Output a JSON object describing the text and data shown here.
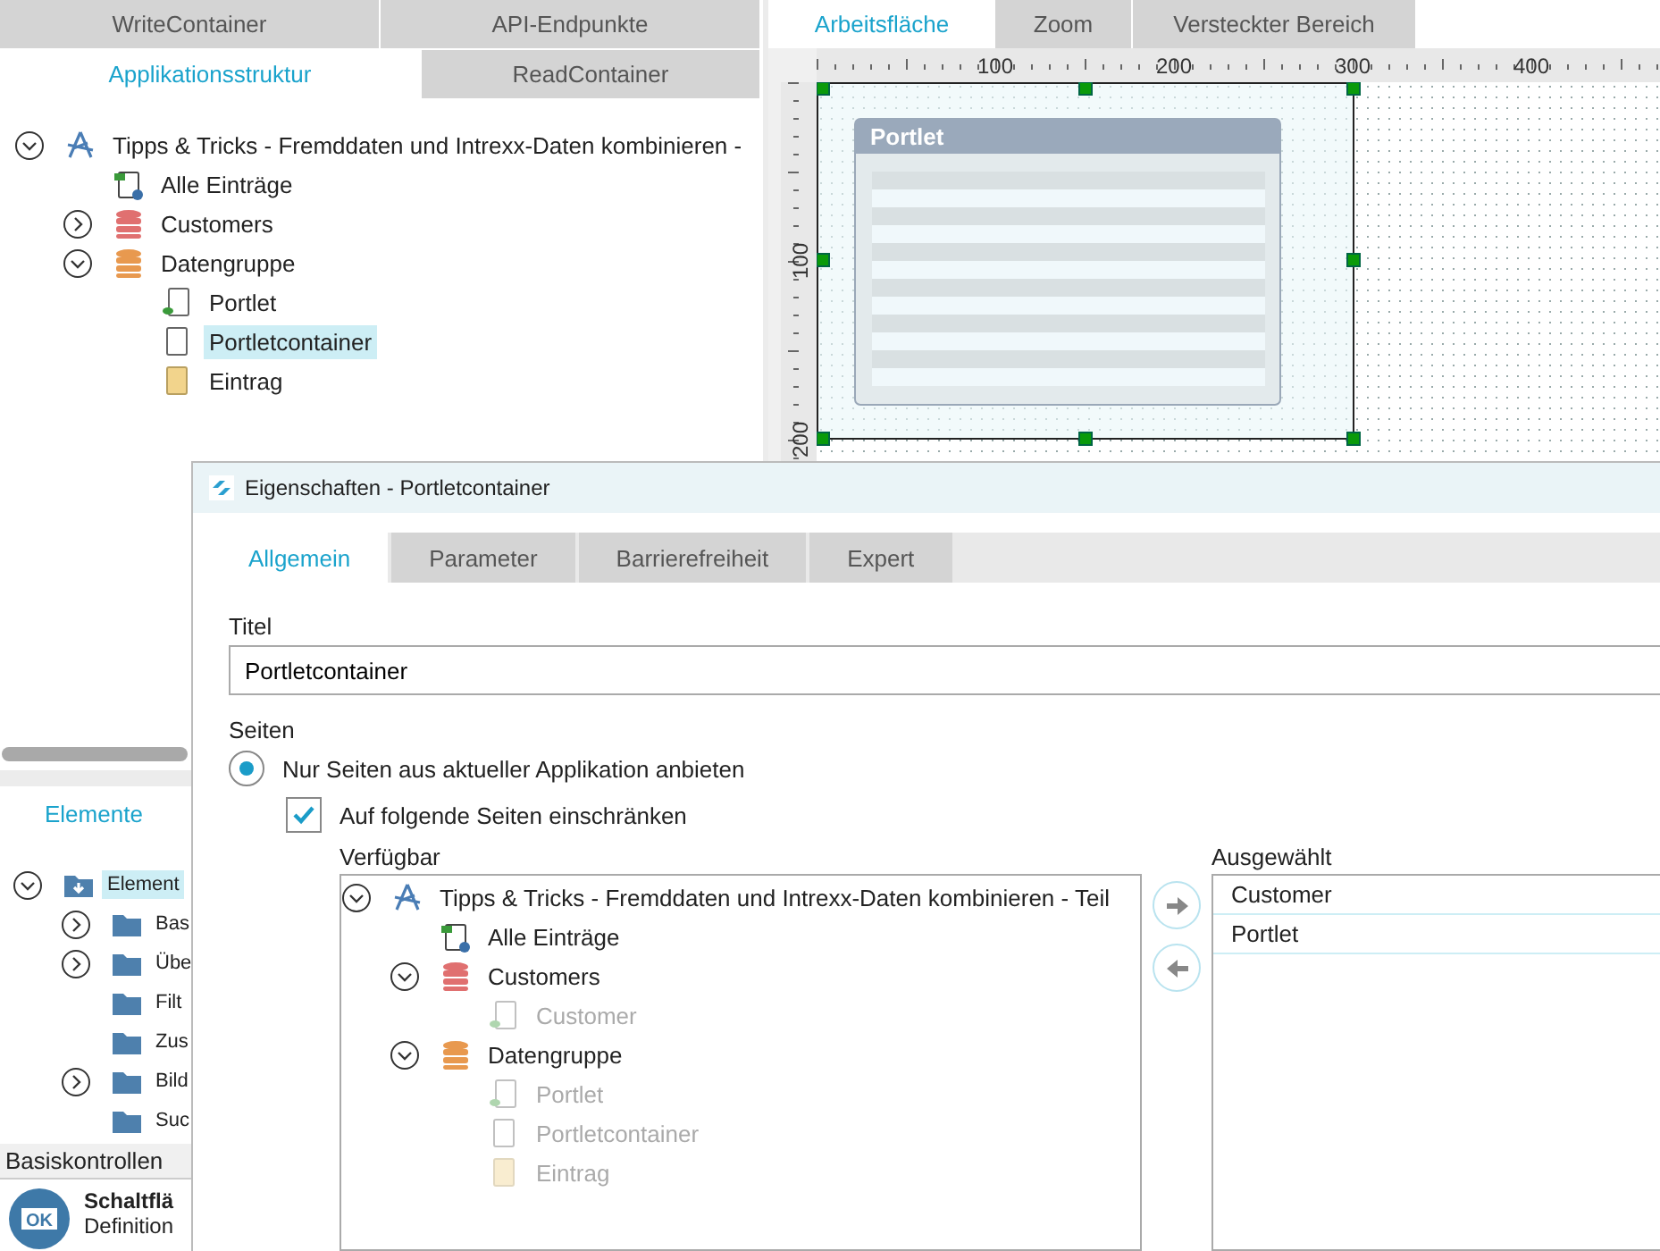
{
  "structure_tabs": [
    [
      {
        "label": "WriteContainer",
        "selected": false
      },
      {
        "label": "API-Endpunkte",
        "selected": false
      }
    ],
    [
      {
        "label": "Applikationsstruktur",
        "selected": true
      },
      {
        "label": "ReadContainer",
        "selected": false
      }
    ]
  ],
  "app_tree": [
    {
      "label": "Tipps & Tricks - Fremddaten und Intrexx-Daten kombinieren -",
      "kind": "application",
      "expanded": true,
      "selected": false,
      "children": [
        {
          "label": "Alle Einträge",
          "kind": "view",
          "selected": false
        },
        {
          "label": "Customers",
          "kind": "table",
          "expanded": false,
          "selected": false
        },
        {
          "label": "Datengruppe",
          "kind": "datagroup",
          "expanded": true,
          "selected": false,
          "children": [
            {
              "label": "Portlet",
              "kind": "portlet",
              "selected": false
            },
            {
              "label": "Portletcontainer",
              "kind": "page",
              "selected": true
            },
            {
              "label": "Eintrag",
              "kind": "entry",
              "selected": false
            }
          ]
        }
      ]
    }
  ],
  "element_tabs": [
    {
      "label": "Elemente",
      "selected": true
    }
  ],
  "element_tree": [
    {
      "label": "Element",
      "kind": "folder-root",
      "expanded": true,
      "selected": true,
      "children": [
        {
          "label": "Bas",
          "kind": "folder",
          "expanded": false,
          "selected": false
        },
        {
          "label": "Übe",
          "kind": "folder",
          "expanded": false,
          "selected": false
        },
        {
          "label": "Filt",
          "kind": "folder",
          "selected": false
        },
        {
          "label": "Zus",
          "kind": "folder",
          "selected": false
        },
        {
          "label": "Bild",
          "kind": "folder",
          "expanded": false,
          "selected": false
        },
        {
          "label": "Suc",
          "kind": "folder",
          "selected": false
        }
      ]
    }
  ],
  "controls_header": "Basiskontrollen",
  "control_item": {
    "icon_text": "OK",
    "title": "Schaltflä",
    "description": "Definition"
  },
  "editor_tabs": [
    {
      "label": "Arbeitsfläche",
      "selected": true
    },
    {
      "label": "Zoom",
      "selected": false
    },
    {
      "label": "Versteckter Bereich",
      "selected": false
    }
  ],
  "ruler": {
    "top_labels": [
      "100",
      "200",
      "300",
      "400"
    ],
    "left_labels": [
      "100",
      "200"
    ]
  },
  "canvas": {
    "portlet_title": "Portlet"
  },
  "dialog": {
    "title": "Eigenschaften - Portletcontainer",
    "tabs": [
      {
        "label": "Allgemein",
        "selected": true
      },
      {
        "label": "Parameter",
        "selected": false
      },
      {
        "label": "Barrierefreiheit",
        "selected": false
      },
      {
        "label": "Expert",
        "selected": false
      }
    ],
    "title_label": "Titel",
    "title_value": "Portletcontainer",
    "pages_label": "Seiten",
    "radio": {
      "label": "Nur Seiten aus aktueller Applikation anbieten",
      "selected": true
    },
    "checkbox": {
      "label": "Auf folgende Seiten einschränken",
      "checked": true
    },
    "available_label": "Verfügbar",
    "available_tree": [
      {
        "label": "Tipps & Tricks - Fremddaten und Intrexx-Daten kombinieren - Teil",
        "kind": "application",
        "expanded": true,
        "disabled": false,
        "children": [
          {
            "label": "Alle Einträge",
            "kind": "view",
            "disabled": false
          },
          {
            "label": "Customers",
            "kind": "table",
            "expanded": true,
            "disabled": false,
            "children": [
              {
                "label": "Customer",
                "kind": "portlet",
                "disabled": true
              }
            ]
          },
          {
            "label": "Datengruppe",
            "kind": "datagroup",
            "expanded": true,
            "disabled": false,
            "children": [
              {
                "label": "Portlet",
                "kind": "portlet",
                "disabled": true
              },
              {
                "label": "Portletcontainer",
                "kind": "page",
                "disabled": true
              },
              {
                "label": "Eintrag",
                "kind": "entry",
                "disabled": true
              }
            ]
          }
        ]
      }
    ],
    "selected_label": "Ausgewählt",
    "selected_items": [
      "Customer",
      "Portlet"
    ]
  }
}
